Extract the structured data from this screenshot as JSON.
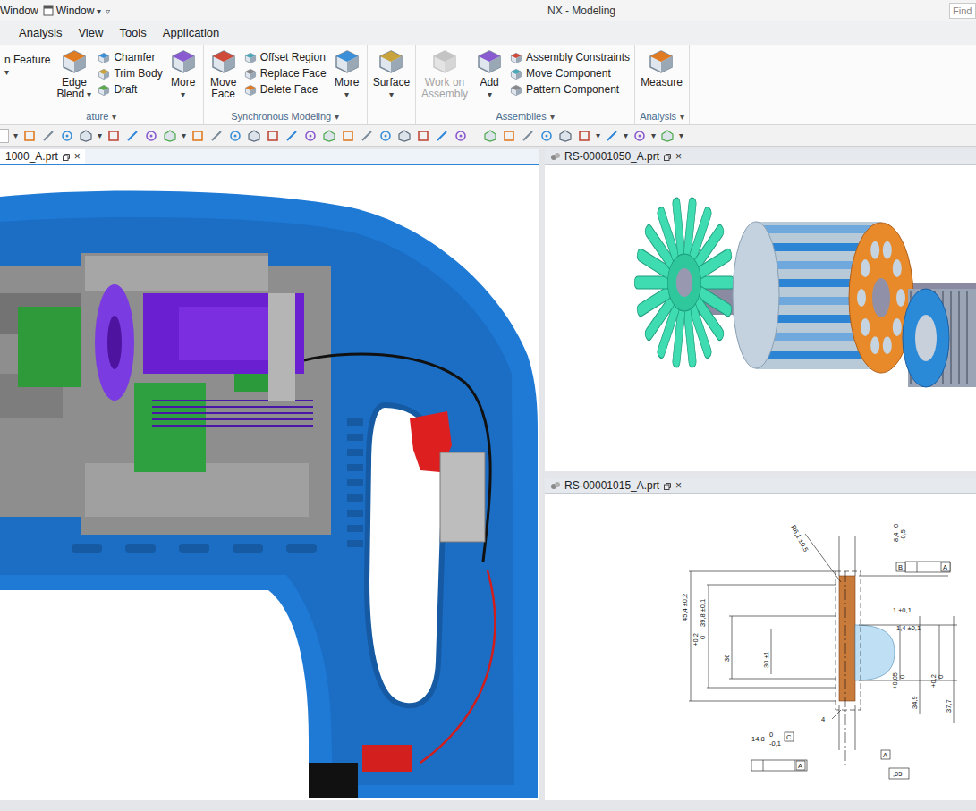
{
  "window": {
    "title": "NX - Modeling",
    "quick_access": [
      {
        "label": "Window",
        "caret": ""
      },
      {
        "label": "Window",
        "caret": "▾"
      }
    ],
    "customize": "▿"
  },
  "search": {
    "placeholder": "Find"
  },
  "menu": [
    {
      "label": "Analysis"
    },
    {
      "label": "View"
    },
    {
      "label": "Tools"
    },
    {
      "label": "Application"
    }
  ],
  "ribbon": {
    "groups": [
      {
        "label": "ature",
        "caret": "▾",
        "items": [
          {
            "kind": "cut",
            "lines": [
              "n Feature"
            ],
            "caret": "▾",
            "disabled": false
          },
          {
            "kind": "large",
            "lines": [
              "Edge",
              "Blend"
            ],
            "caret": "▾",
            "disabled": false
          },
          {
            "kind": "stack",
            "entries": [
              {
                "label": "Chamfer"
              },
              {
                "label": "Trim Body"
              },
              {
                "label": "Draft"
              }
            ]
          },
          {
            "kind": "large",
            "lines": [
              "More"
            ],
            "caret": "▾",
            "disabled": false
          }
        ]
      },
      {
        "label": "Synchronous Modeling",
        "caret": "▾",
        "items": [
          {
            "kind": "large",
            "lines": [
              "Move",
              "Face"
            ],
            "caret": "",
            "disabled": false
          },
          {
            "kind": "stack",
            "entries": [
              {
                "label": "Offset Region"
              },
              {
                "label": "Replace Face"
              },
              {
                "label": "Delete Face"
              }
            ]
          },
          {
            "kind": "large",
            "lines": [
              "More"
            ],
            "caret": "▾",
            "disabled": false
          }
        ]
      },
      {
        "items": [
          {
            "kind": "large",
            "lines": [
              "Surface"
            ],
            "caret": "▾",
            "disabled": false
          }
        ]
      },
      {
        "label": "Assemblies",
        "caret": "▾",
        "items": [
          {
            "kind": "large",
            "lines": [
              "Work on",
              "Assembly"
            ],
            "caret": "",
            "disabled": true
          },
          {
            "kind": "large",
            "lines": [
              "Add"
            ],
            "caret": "▾",
            "disabled": false
          },
          {
            "kind": "stack",
            "entries": [
              {
                "label": "Assembly Constraints"
              },
              {
                "label": "Move Component"
              },
              {
                "label": "Pattern Component"
              }
            ]
          }
        ]
      },
      {
        "label": "Analysis",
        "caret": "▾",
        "items": [
          {
            "kind": "large",
            "lines": [
              "Measure"
            ],
            "caret": "",
            "disabled": false
          }
        ]
      }
    ]
  },
  "toolbar": {
    "groups": [
      {
        "icons": 0,
        "caret": "▾"
      },
      {
        "icons": 4,
        "caret": "▾"
      },
      {
        "icons": 4,
        "caret": "▾"
      },
      {
        "icons": 15
      },
      {
        "icons": 6,
        "caret": "▾"
      },
      {
        "icons": 1,
        "caret": "▾"
      },
      {
        "icons": 1,
        "caret": "▾"
      },
      {
        "icons": 1,
        "caret": "▾"
      }
    ]
  },
  "documents": [
    {
      "title": "1000_A.prt",
      "close": "×",
      "selected": true
    },
    {
      "title": "RS-00001050_A.prt",
      "close": "×",
      "selected": false
    },
    {
      "title": "RS-00001015_A.prt",
      "close": "×",
      "selected": false
    }
  ],
  "drawing": {
    "labels": [
      {
        "text": "R6,1 ±0,5",
        "kind": "dim"
      },
      {
        "text": "8,4",
        "kind": "dim"
      },
      {
        "text": "0",
        "kind": "dim"
      },
      {
        "text": "-0,5",
        "kind": "dim"
      },
      {
        "text": "B",
        "kind": "datum"
      },
      {
        "text": "A",
        "kind": "datum"
      },
      {
        "text": "45,4 ±0,2",
        "kind": "dim"
      },
      {
        "text": "39,8 ±0,1",
        "kind": "dim"
      },
      {
        "text": "+0,2",
        "kind": "dim"
      },
      {
        "text": "0",
        "kind": "dim"
      },
      {
        "text": "36",
        "kind": "dim"
      },
      {
        "text": "30 ±1",
        "kind": "dim"
      },
      {
        "text": "1 ±0,1",
        "kind": "dim"
      },
      {
        "text": "1,4 ±0,1",
        "kind": "dim"
      },
      {
        "text": "+0,05",
        "kind": "dim"
      },
      {
        "text": "0",
        "kind": "dim"
      },
      {
        "text": "34,9",
        "kind": "dim"
      },
      {
        "text": "+0,2",
        "kind": "dim"
      },
      {
        "text": "0",
        "kind": "dim"
      },
      {
        "text": "37,7",
        "kind": "dim"
      },
      {
        "text": "14,8",
        "kind": "dim"
      },
      {
        "text": "0",
        "kind": "dim"
      },
      {
        "text": "-0,1",
        "kind": "dim"
      },
      {
        "text": "C",
        "kind": "datum"
      },
      {
        "text": "4",
        "kind": "dim"
      },
      {
        "text": "A",
        "kind": "datum"
      },
      {
        "text": "A",
        "kind": "datum"
      },
      {
        "text": ",05",
        "kind": "dim"
      }
    ]
  }
}
